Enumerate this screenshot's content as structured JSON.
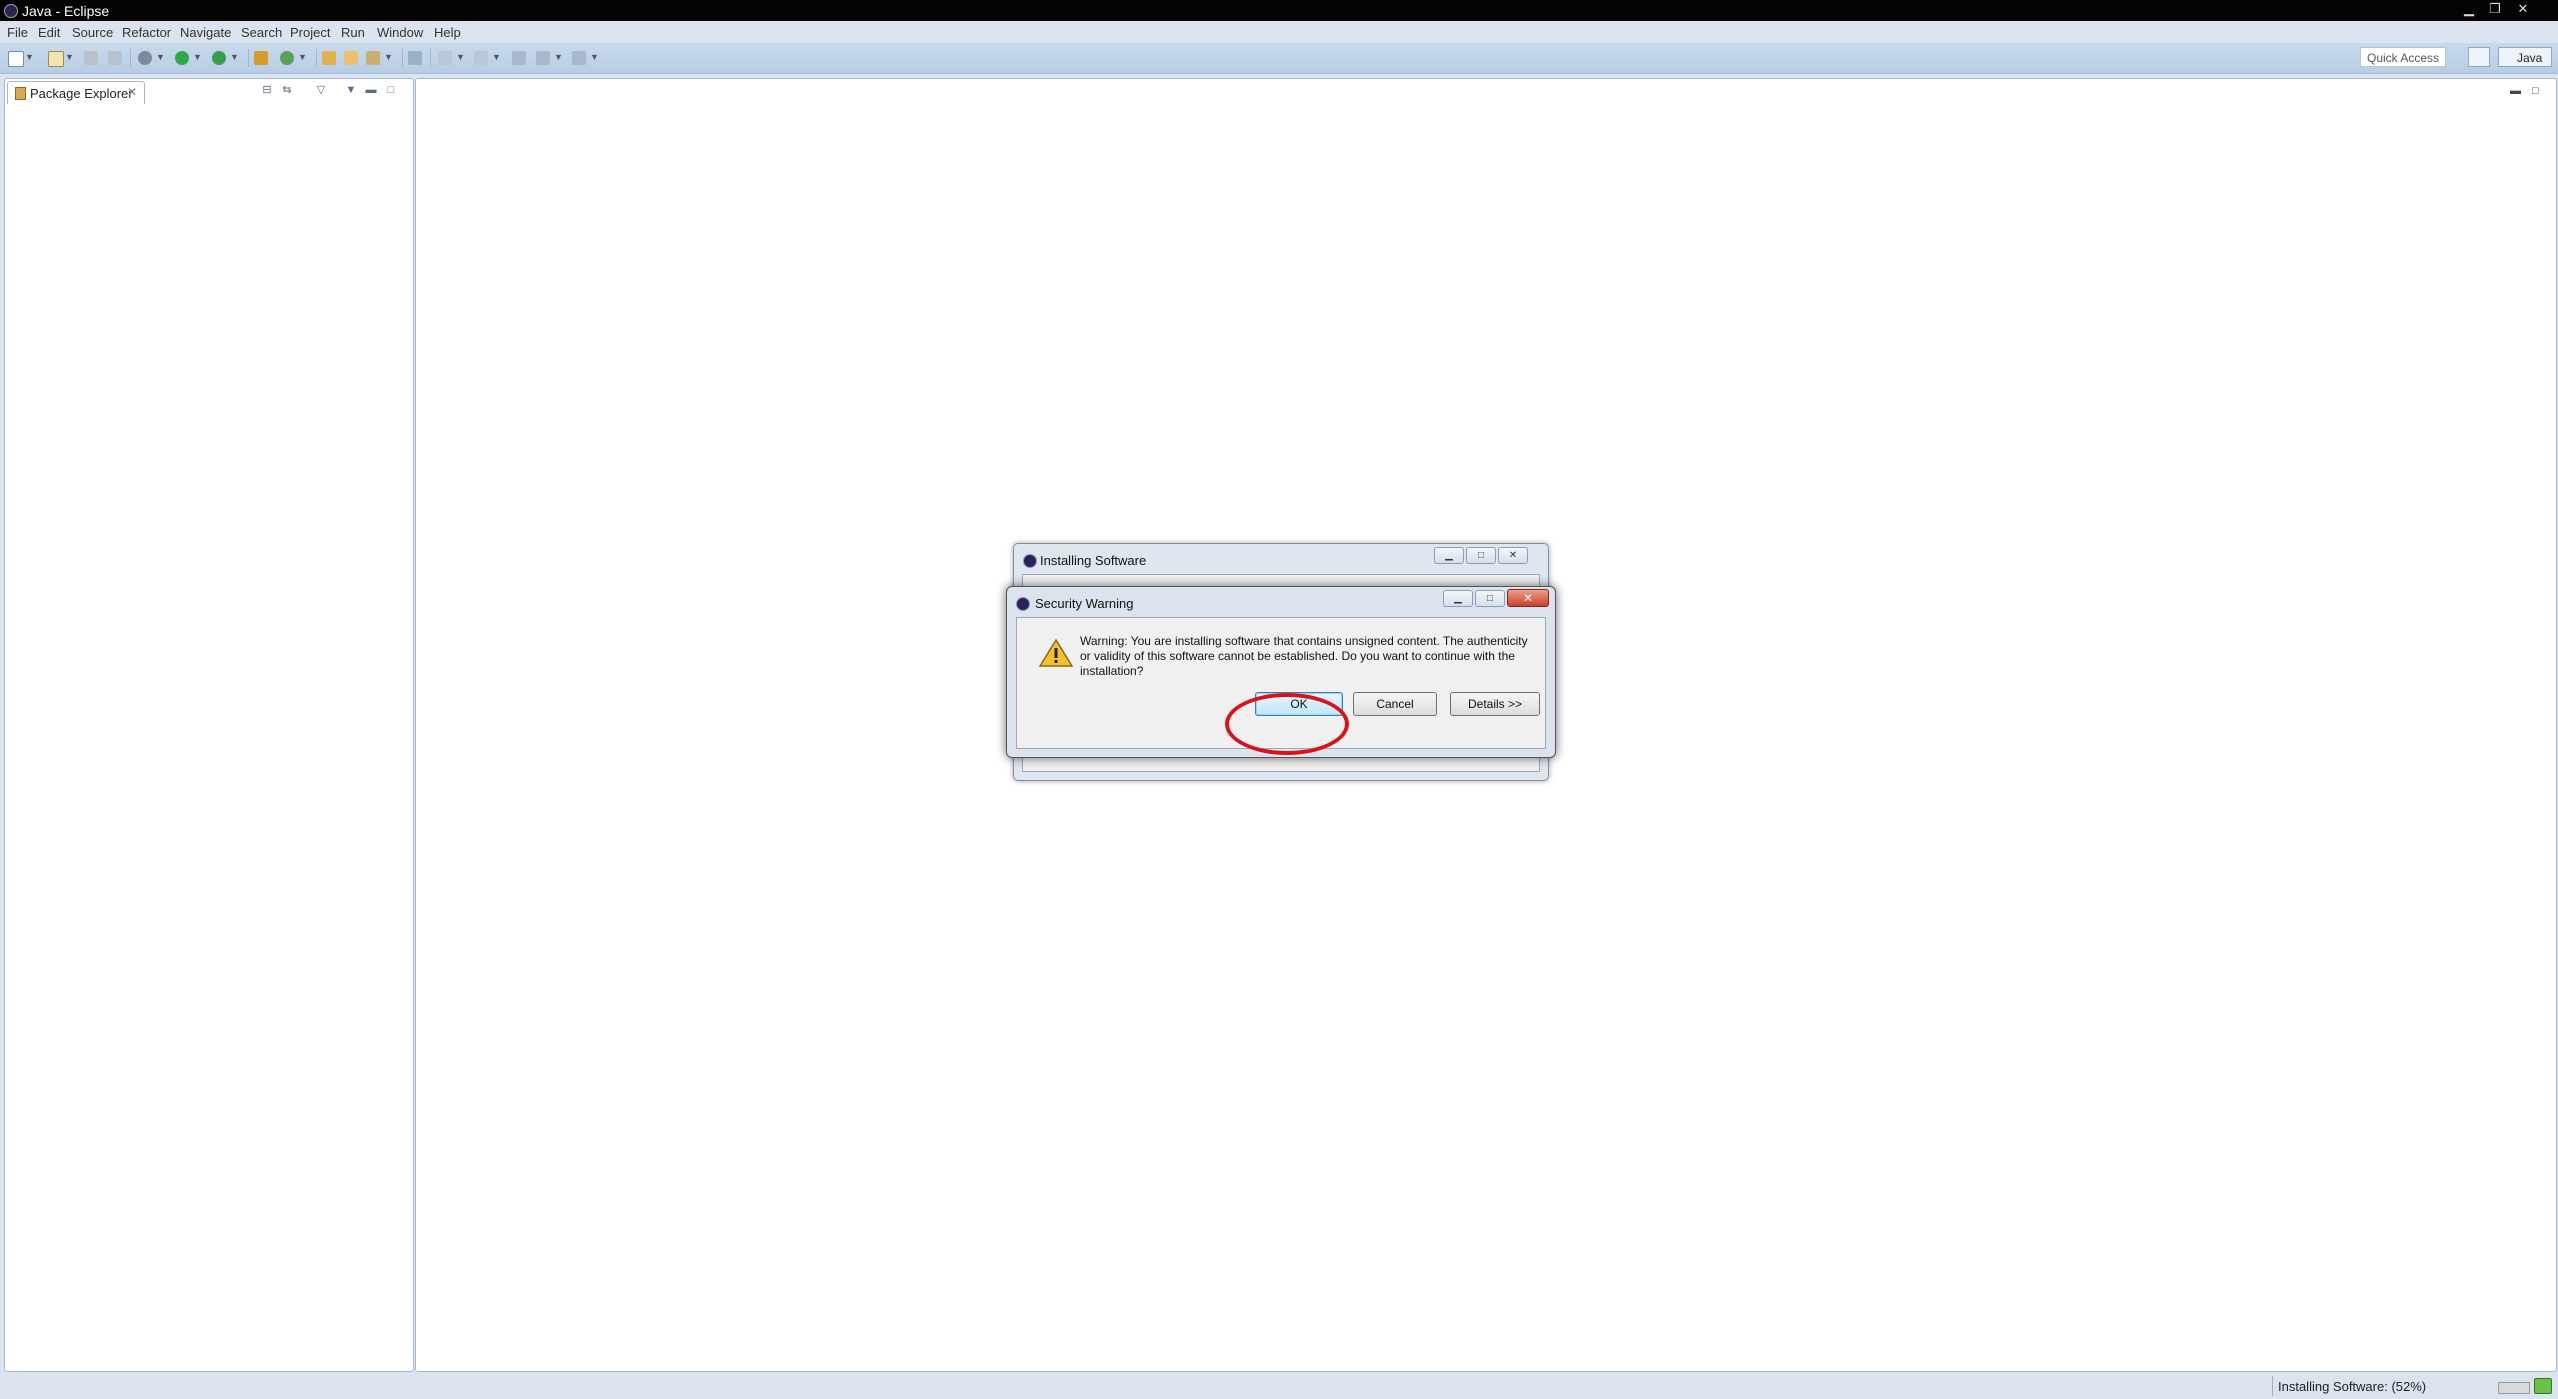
{
  "window": {
    "title": "Java - Eclipse"
  },
  "menu": [
    "File",
    "Edit",
    "Source",
    "Refactor",
    "Navigate",
    "Search",
    "Project",
    "Run",
    "Window",
    "Help"
  ],
  "toolbar": {
    "quick_access": "Quick Access",
    "perspective": "Java"
  },
  "left_panel": {
    "tab_label": "Package Explorer"
  },
  "status_bar": {
    "text": "Installing Software: (52%)"
  },
  "dialog_back": {
    "title": "Installing Software"
  },
  "dialog_front": {
    "title": "Security Warning",
    "message": "Warning: You are installing software that contains unsigned content. The authenticity or validity of this software cannot be established. Do you want to continue with the installation?",
    "buttons": {
      "ok": "OK",
      "cancel": "Cancel",
      "details": "Details >>"
    }
  },
  "annotation": {
    "color": "#d8131c"
  },
  "colors": {
    "accent": "#3c7fb1",
    "titlebar": "#040404",
    "close_button": "#c9412a"
  }
}
